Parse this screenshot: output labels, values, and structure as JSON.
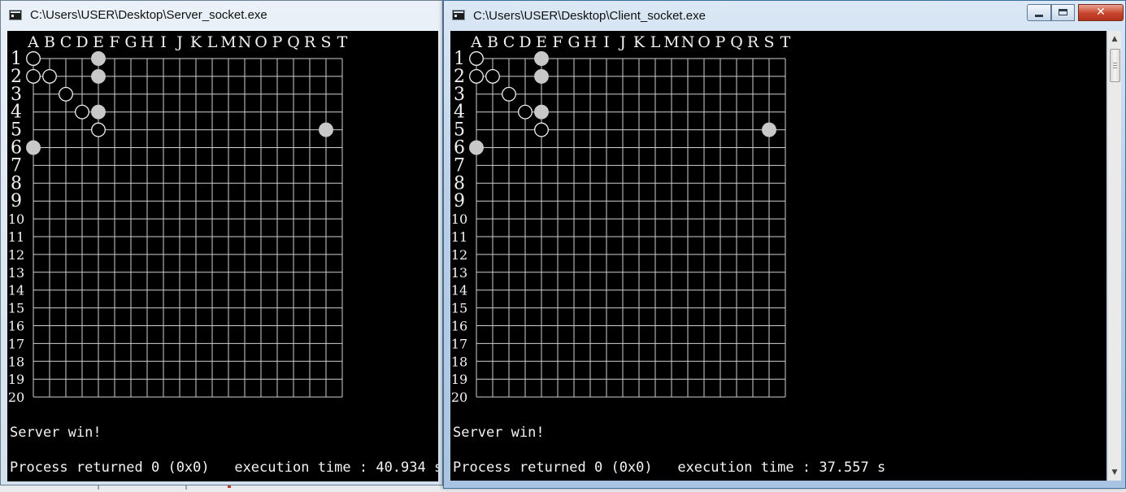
{
  "windows": [
    {
      "id": "server",
      "title": "C:\\Users\\USER\\Desktop\\Server_socket.exe",
      "message": "Server win!",
      "process_line": "Process returned 0 (0x0)   execution time : 40.934 s"
    },
    {
      "id": "client",
      "title": "C:\\Users\\USER\\Desktop\\Client_socket.exe",
      "message": "Server win!",
      "process_line": "Process returned 0 (0x0)   execution time : 37.557 s"
    }
  ],
  "board": {
    "columns": [
      "A",
      "B",
      "C",
      "D",
      "E",
      "F",
      "G",
      "H",
      "I",
      "J",
      "K",
      "L",
      "M",
      "N",
      "O",
      "P",
      "Q",
      "R",
      "S",
      "T"
    ],
    "rows": [
      "1",
      "2",
      "3",
      "4",
      "5",
      "6",
      "7",
      "8",
      "9",
      "10",
      "11",
      "12",
      "13",
      "14",
      "15",
      "16",
      "17",
      "18",
      "19",
      "20"
    ],
    "stones": [
      {
        "col": "A",
        "row": 1,
        "color": "white-hollow"
      },
      {
        "col": "E",
        "row": 1,
        "color": "gray-filled"
      },
      {
        "col": "A",
        "row": 2,
        "color": "white-hollow"
      },
      {
        "col": "B",
        "row": 2,
        "color": "white-hollow"
      },
      {
        "col": "E",
        "row": 2,
        "color": "gray-filled"
      },
      {
        "col": "C",
        "row": 3,
        "color": "white-hollow"
      },
      {
        "col": "D",
        "row": 4,
        "color": "white-hollow"
      },
      {
        "col": "E",
        "row": 4,
        "color": "gray-filled"
      },
      {
        "col": "E",
        "row": 5,
        "color": "white-hollow"
      },
      {
        "col": "S",
        "row": 5,
        "color": "gray-filled"
      },
      {
        "col": "A",
        "row": 6,
        "color": "gray-filled"
      }
    ]
  },
  "colors": {
    "console_bg": "#000000",
    "console_text": "#f2f2f2",
    "grid_line": "#cfcfcf",
    "gray_stone": "#c8c8c8",
    "close_button": "#c8442c"
  },
  "icons": {
    "window_icon": "console-app-icon",
    "minimize": "minimize-icon",
    "maximize": "maximize-icon",
    "close": "close-icon",
    "scroll_up": "scroll-up-arrow-icon",
    "scroll_down": "scroll-down-arrow-icon"
  },
  "controls": {
    "close_glyph": "✕",
    "scroll_up_glyph": "▲",
    "scroll_down_glyph": "▼"
  }
}
